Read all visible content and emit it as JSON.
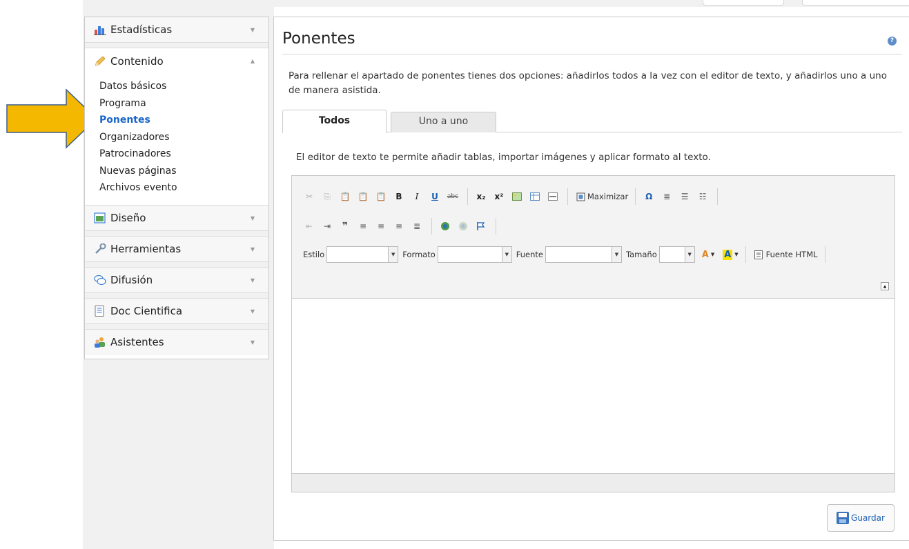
{
  "sidebar": {
    "sections": {
      "estadisticas": {
        "label": "Estadísticas"
      },
      "contenido": {
        "label": "Contenido",
        "items": [
          "Datos básicos",
          "Programa",
          "Ponentes",
          "Organizadores",
          "Patrocinadores",
          "Nuevas páginas",
          "Archivos evento"
        ],
        "active_item": "Ponentes"
      },
      "diseno": {
        "label": "Diseño"
      },
      "herramientas": {
        "label": "Herramientas"
      },
      "difusion": {
        "label": "Difusión"
      },
      "doc_cientifica": {
        "label": "Doc Cientifica"
      },
      "asistentes": {
        "label": "Asistentes"
      }
    }
  },
  "main": {
    "title": "Ponentes",
    "help_icon": "help-icon",
    "intro": "Para rellenar el apartado de ponentes tienes dos opciones: añadirlos todos a la vez con el editor de texto, y añadirlos uno a uno de manera asistida.",
    "tabs": [
      {
        "label": "Todos",
        "active": true
      },
      {
        "label": "Uno a uno",
        "active": false
      }
    ],
    "editor_description": "El editor de texto te permite añadir tablas, importar imágenes y aplicar formato al texto."
  },
  "editor": {
    "toolbar": {
      "maximize_label": "Maximizar",
      "style_label": "Estilo",
      "format_label": "Formato",
      "font_label": "Fuente",
      "size_label": "Tamaño",
      "source_label": "Fuente HTML",
      "row1_icons": [
        "cut-icon",
        "copy-icon",
        "paste-icon",
        "paste-text-icon",
        "paste-word-icon",
        "bold-icon",
        "italic-icon",
        "underline-icon",
        "strikethrough-icon",
        "subscript-icon",
        "superscript-icon",
        "image-icon",
        "table-icon",
        "horizontal-rule-icon",
        "maximize-icon",
        "special-char-icon",
        "blockquote-indent-icon",
        "numbered-list-icon",
        "bulleted-list-icon"
      ],
      "row2_icons": [
        "outdent-icon",
        "indent-icon",
        "blockquote-icon",
        "align-left-icon",
        "align-center-icon",
        "align-right-icon",
        "align-justify-icon",
        "link-icon",
        "unlink-icon",
        "anchor-icon"
      ]
    }
  },
  "actions": {
    "save_label": "Guardar"
  },
  "colors": {
    "accent": "#1a66c8",
    "arrow_fill": "#f5b800",
    "arrow_stroke": "#3a5f8f"
  }
}
